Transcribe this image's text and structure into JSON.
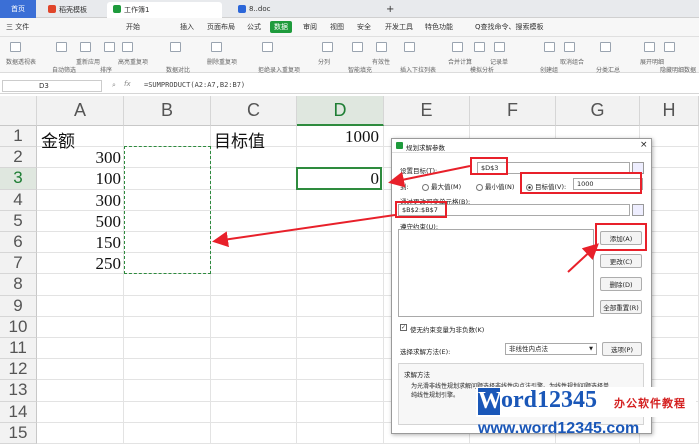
{
  "tabs": {
    "home": "首页",
    "tab1": "稻壳模板",
    "tab2": "工作簿1",
    "tab3": "8..doc",
    "add": "+"
  },
  "menu": {
    "file": "三 文件",
    "items": [
      "开始",
      "插入",
      "页面布局",
      "公式",
      "数据",
      "审阅",
      "视图",
      "安全",
      "开发工具",
      "特色功能"
    ],
    "active_index": 4,
    "search": "Q查找命令、搜索模板"
  },
  "ribbon": {
    "labels": [
      "数据透视表",
      "自动筛选",
      "重新应用",
      "排序",
      "高亮重复项",
      "数据对比",
      "删除重复项",
      "拒绝录入重复项",
      "分列",
      "智能填充",
      "有效性",
      "插入下拉列表",
      "合并计算",
      "模拟分析",
      "记录单",
      "创建组",
      "取消组合",
      "分类汇总",
      "展开明细",
      "隐藏明细数据"
    ]
  },
  "formula_bar": {
    "name_box": "D3",
    "fx": "fx",
    "formula": "=SUMPRODUCT(A2:A7,B2:B7)"
  },
  "sheet": {
    "columns": [
      "A",
      "B",
      "C",
      "D",
      "E",
      "F",
      "G",
      "H"
    ],
    "rows": [
      "1",
      "2",
      "3",
      "4",
      "5",
      "6",
      "7",
      "8",
      "9",
      "10",
      "11",
      "12",
      "13",
      "14",
      "15"
    ],
    "a1": "金额",
    "c1": "目标值",
    "d1": "1000",
    "d3": "0",
    "a_values": [
      "300",
      "100",
      "300",
      "500",
      "150",
      "250"
    ]
  },
  "dialog": {
    "title": "规划求解参数",
    "set_target_label": "设置目标(T):",
    "set_target_value": "$D$3",
    "to_label": "到:",
    "opt_max": "最大值(M)",
    "opt_min": "最小值(N)",
    "opt_value": "目标值(V):",
    "target_value": "1000",
    "changing_label": "通过更改可变单元格(B):",
    "changing_value": "$B$2:$B$7",
    "constraints_label": "遵守约束(U):",
    "btn_add": "添加(A)",
    "btn_change": "更改(C)",
    "btn_delete": "删除(D)",
    "btn_reset": "全部重置(R)",
    "nonneg_label": "使无约束变量为非负数(K)",
    "method_label": "选择求解方法(E):",
    "method_value": "非线性内点法",
    "btn_options": "选项(P)",
    "desc_title": "求解方法",
    "desc_text1": "为光滑非线性规划求解问题选择非线性内点法引擎。为线性规划问题选择单",
    "desc_text2": "纯线性规划引擎。"
  },
  "watermark": {
    "brand_w": "W",
    "brand_rest": "ord12345",
    "tag": "办公软件教程",
    "url": "www.word12345.com"
  },
  "colors": {
    "accent": "#1e9b3c",
    "annotation": "#e8202a",
    "dialog_icon": "#1e9b3c"
  }
}
